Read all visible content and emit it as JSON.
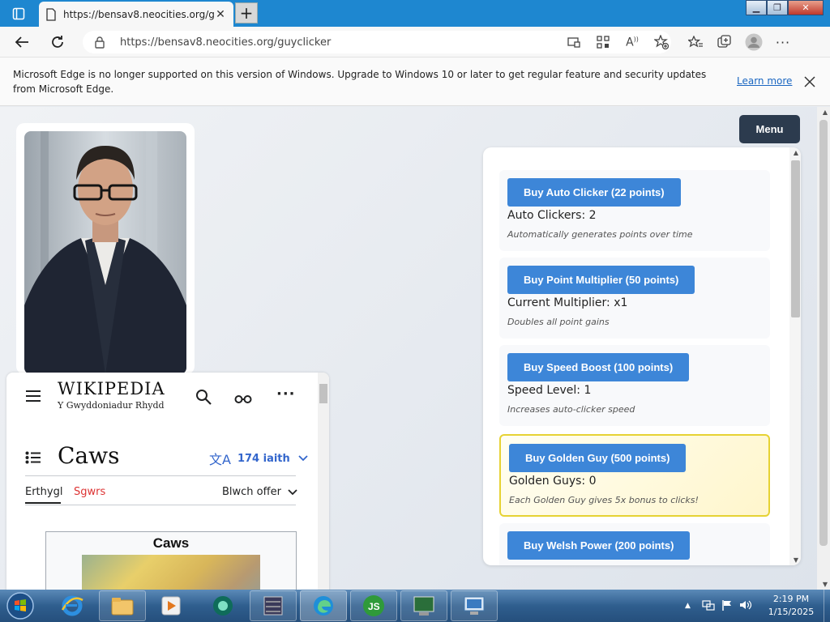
{
  "browser": {
    "tab_title": "https://bensav8.neocities.org/gu",
    "url": "https://bensav8.neocities.org/guyclicker"
  },
  "infobar": {
    "message": "Microsoft Edge is no longer supported on this version of Windows. Upgrade to Windows 10 or later to get regular feature and security updates from Microsoft Edge.",
    "learn_more": "Learn more"
  },
  "page": {
    "menu_label": "Menu"
  },
  "wikipedia": {
    "logo": "WIKIPEDIA",
    "tagline": "Y Gwyddoniadur Rhydd",
    "title": "Caws",
    "languages": "174 iaith",
    "tabs": [
      "Erthygl",
      "Sgwrs"
    ],
    "toolbox": "Blwch offer",
    "infobox_title": "Caws"
  },
  "shop": {
    "upgrades": [
      {
        "button": "Buy Auto Clicker (22 points)",
        "status": "Auto Clickers: 2",
        "description": "Automatically generates points over time"
      },
      {
        "button": "Buy Point Multiplier (50 points)",
        "status": "Current Multiplier: x1",
        "description": "Doubles all point gains"
      },
      {
        "button": "Buy Speed Boost (100 points)",
        "status": "Speed Level: 1",
        "description": "Increases auto-clicker speed"
      },
      {
        "button": "Buy Golden Guy (500 points)",
        "status": "Golden Guys: 0",
        "description": "Each Golden Guy gives 5x bonus to clicks!"
      },
      {
        "button": "Buy Welsh Power (200 points)"
      }
    ]
  },
  "taskbar": {
    "time": "2:19 PM",
    "date": "1/15/2025"
  }
}
